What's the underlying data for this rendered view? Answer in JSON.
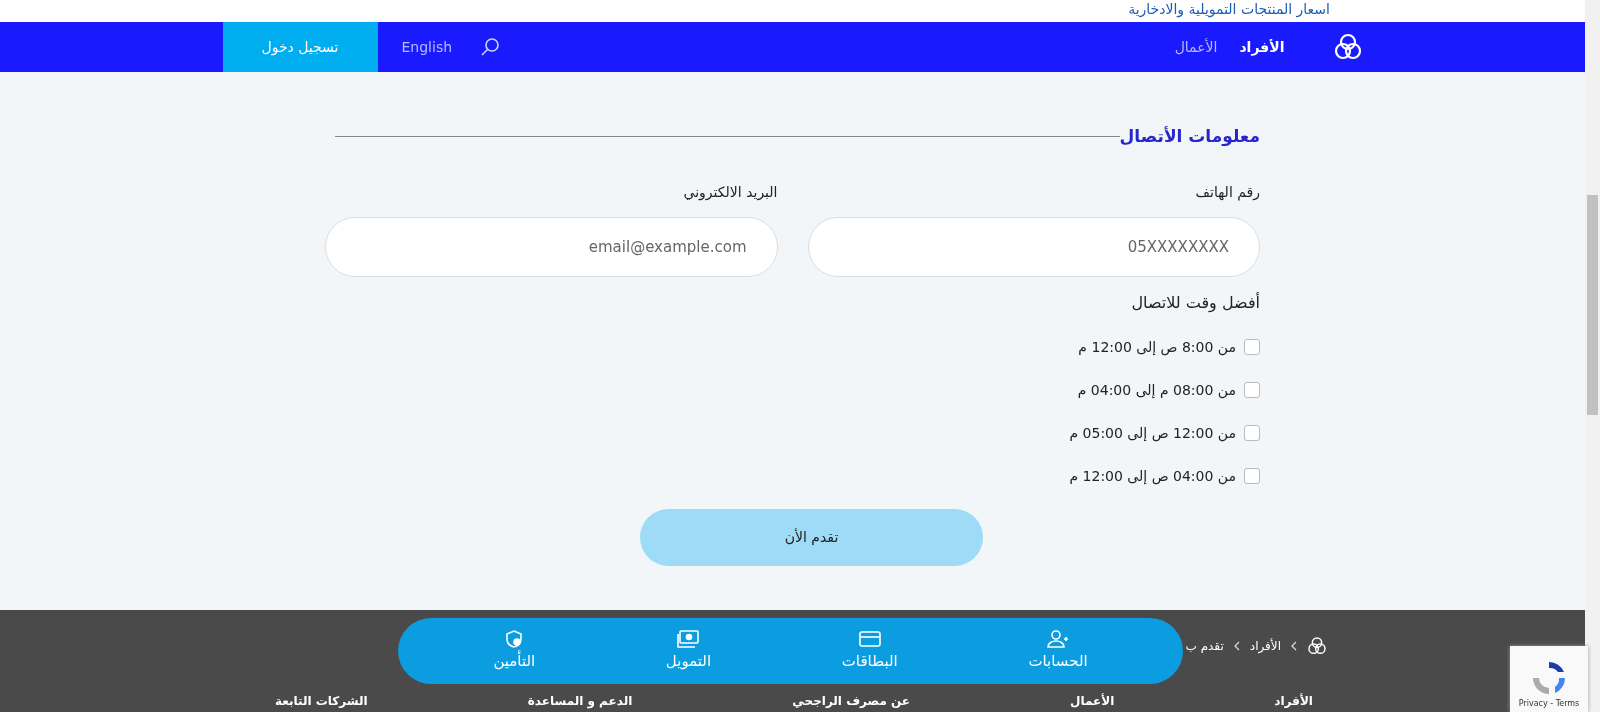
{
  "top_link": "اسعار المنتجات التمويلية والادخارية",
  "nav": {
    "items": [
      {
        "label": "الأفراد",
        "selected": true
      },
      {
        "label": "الأعمال",
        "selected": false
      }
    ],
    "language": "English",
    "login": "تسجيل دخول"
  },
  "section": {
    "title": "معلومات الأتصال",
    "fields": [
      {
        "label": "رقم الهاتف",
        "placeholder": "05XXXXXXXX"
      },
      {
        "label": "البريد الالكتروني",
        "placeholder": "email@example.com"
      }
    ],
    "time_title": "أفضل وقت للاتصال",
    "times": [
      {
        "label": "من 8:00 ص إلى 12:00 م",
        "checked": false
      },
      {
        "label": "من 08:00 م إلى 04:00 م",
        "checked": false
      },
      {
        "label": "من 12:00 ص إلى 05:00 م",
        "checked": false
      },
      {
        "label": "من 04:00 ص إلى 12:00 م",
        "checked": false
      }
    ],
    "submit": "تقدم الأن"
  },
  "breadcrumb": [
    "الأفراد",
    "تقدم ب"
  ],
  "bottom_nav": [
    {
      "kind": "accounts",
      "label": "الحسابات"
    },
    {
      "kind": "cards",
      "label": "البطاقات"
    },
    {
      "kind": "finance",
      "label": "التمويل"
    },
    {
      "kind": "insurance",
      "label": "التأمين"
    }
  ],
  "footer_columns": [
    "الأفراد",
    "الأعمال",
    "عن مصرف الراجحي",
    "الدعم و المساعدة",
    "الشركات التابعة"
  ],
  "recaptcha": "Privacy - Terms"
}
